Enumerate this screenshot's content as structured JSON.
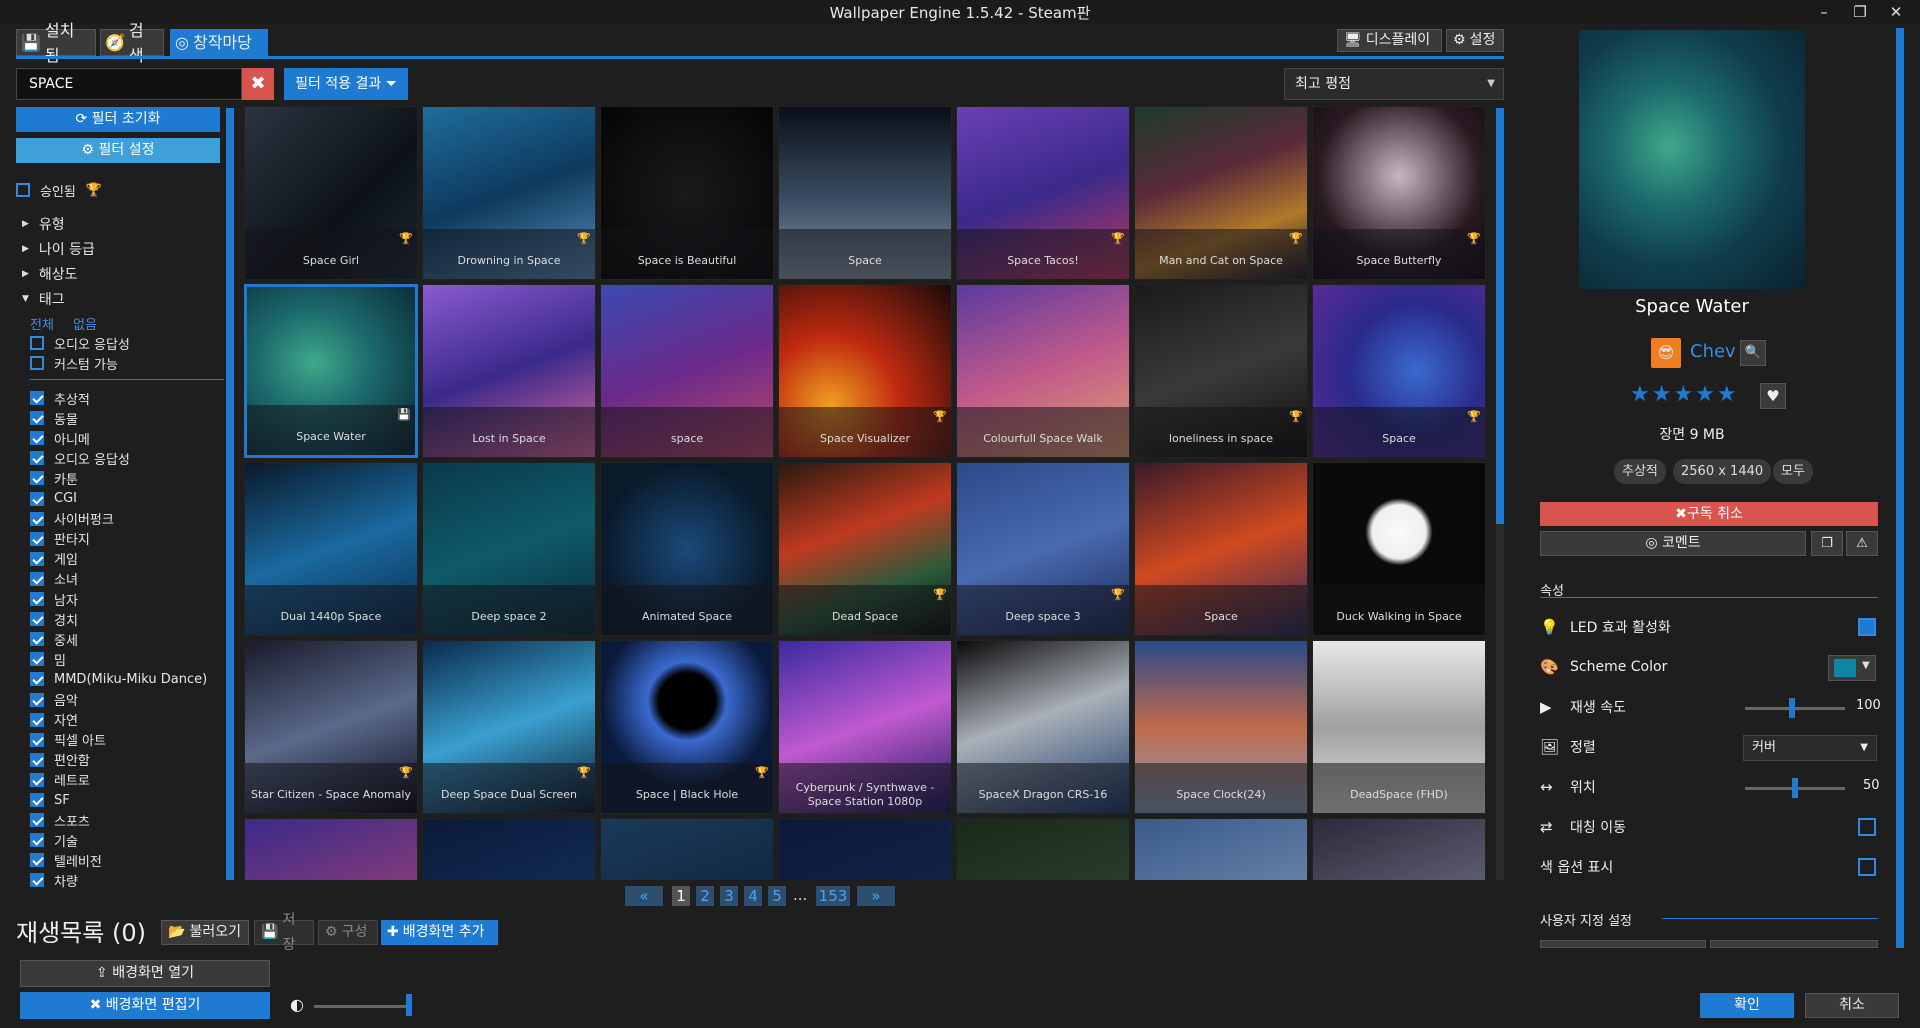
{
  "window": {
    "title": "Wallpaper Engine 1.5.42 - Steam판",
    "min": "–",
    "max": "❐",
    "close": "✕"
  },
  "tabs": [
    {
      "label": "설치됨",
      "icon": "save-icon"
    },
    {
      "label": "검색",
      "icon": "compass-icon"
    },
    {
      "label": "창작마당",
      "icon": "steam-icon",
      "active": true
    }
  ],
  "toolbar": {
    "display": "디스플레이",
    "settings": "설정"
  },
  "search": {
    "value": "SPACE",
    "clear": "✖",
    "filter_applied": "필터 적용 결과"
  },
  "sort": {
    "value": "최고 평점"
  },
  "filters": {
    "reset": "필터 초기화",
    "settings": "필터 설정",
    "approved": "승인됨",
    "sections": [
      "유형",
      "나이 등급",
      "해상도"
    ],
    "tags_label": "태그",
    "all": "전체",
    "none": "없음",
    "unchecked": [
      "오디오 응답성",
      "커스텀 가능"
    ],
    "tags": [
      "추상적",
      "동물",
      "아니메",
      "오디오 응답성",
      "카툰",
      "CGI",
      "사이버펑크",
      "판타지",
      "게임",
      "소녀",
      "남자",
      "경치",
      "중세",
      "밈",
      "MMD(Miku-Miku Dance)",
      "음악",
      "자연",
      "픽셀 아트",
      "편안함",
      "레트로",
      "SF",
      "스포츠",
      "기술",
      "텔레비전",
      "차량"
    ]
  },
  "grid": {
    "items": [
      {
        "title": "Space Girl",
        "trophy": true,
        "bg": "linear-gradient(135deg,#2a3440,#0d1218 60%,#1a2632)"
      },
      {
        "title": "Drowning in Space",
        "trophy": true,
        "bg": "linear-gradient(160deg,#1f6d9c,#0d3a5e 50%,#5a8fb7)"
      },
      {
        "title": "Space is Beautiful",
        "trophy": false,
        "bg": "radial-gradient(circle at 50% 50%,#1a1a1a,#050505)"
      },
      {
        "title": "Space",
        "trophy": false,
        "bg": "linear-gradient(180deg,#0a0f18,#3c4e63 55%,#8899aa)"
      },
      {
        "title": "Space Tacos!",
        "trophy": true,
        "bg": "linear-gradient(160deg,#6b3fb5,#3a2a8a 50%,#c03a5c)"
      },
      {
        "title": "Man and Cat on Space",
        "trophy": true,
        "bg": "linear-gradient(160deg,#1d3b2a,#5a2a3a 40%,#b0782a 70%,#1a1a2a)"
      },
      {
        "title": "Space Butterfly",
        "trophy": true,
        "bg": "radial-gradient(circle at 50% 40%,#c9b7c0,#2a1a22 60%,#0e0a0e)"
      },
      {
        "title": "Space Water",
        "trophy": false,
        "saved": true,
        "bg": "radial-gradient(ellipse at 40% 45%,#3fa98a,#1c6a6c 40%,#0a2230)"
      },
      {
        "title": "Lost in Space",
        "trophy": false,
        "bg": "linear-gradient(160deg,#8a5ad0,#3a2a8a 50%,#e06aa0)"
      },
      {
        "title": "space",
        "trophy": false,
        "bg": "linear-gradient(160deg,#3a4ab0,#6a2a8a 50%,#c04a6a)"
      },
      {
        "title": "Space Visualizer",
        "trophy": true,
        "bg": "radial-gradient(circle at 30% 70%,#f0a020,#c02a10 40%,#1a0a0a)"
      },
      {
        "title": "Colourfull Space Walk",
        "trophy": false,
        "bg": "linear-gradient(160deg,#5a3aa0,#c05a8a 50%,#e0a070)"
      },
      {
        "title": "loneliness in space",
        "trophy": true,
        "bg": "linear-gradient(160deg,#1a1a1a,#3a3a3a 50%,#0e0e0e)"
      },
      {
        "title": "Space",
        "trophy": true,
        "bg": "radial-gradient(circle at 60% 50%,#3a6ad0,#2a2a8a 50%,#5a2a9a)"
      },
      {
        "title": "Dual 1440p Space",
        "trophy": false,
        "bg": "linear-gradient(160deg,#0a1a2a,#1a6aa0 50%,#0a2a4a)"
      },
      {
        "title": "Deep space 2",
        "trophy": false,
        "bg": "linear-gradient(160deg,#0a3a4a,#0e5a6a 50%,#0a2a3a)"
      },
      {
        "title": "Animated Space",
        "trophy": false,
        "bg": "radial-gradient(circle at 50% 50%,#1a4a7a,#0a1a2a 70%)"
      },
      {
        "title": "Dead Space",
        "trophy": true,
        "bg": "linear-gradient(160deg,#2a1a10,#c03a20 40%,#2a5a3a 70%,#0a0a0a)"
      },
      {
        "title": "Deep space 3",
        "trophy": true,
        "bg": "linear-gradient(160deg,#2a4a8a,#4a6ab0 50%,#1a2a5a)"
      },
      {
        "title": "Space",
        "trophy": false,
        "bg": "linear-gradient(160deg,#3a1a2a,#d04a20 50%,#2a2a5a)"
      },
      {
        "title": "Duck Walking in Space",
        "trophy": false,
        "bg": "radial-gradient(circle at 50% 40%,#fafafa,#f0f0f0 20%,#0a0a0a 25%)"
      },
      {
        "title": "Star Citizen - Space Anomaly",
        "trophy": true,
        "bg": "linear-gradient(160deg,#1a1a2a,#5a6a8a 50%,#0a0a1a)"
      },
      {
        "title": "Deep Space Dual Screen",
        "trophy": true,
        "bg": "linear-gradient(160deg,#0a2a4a,#3aa0d0 50%,#0a1a2a)"
      },
      {
        "title": "Space | Black Hole",
        "trophy": true,
        "bg": "radial-gradient(circle at 50% 35%,#000,#000 20%,#3a6ad0 28%,#0a1a3a 60%)"
      },
      {
        "title": "Cyberpunk / Synthwave - Space Station 1080p",
        "trophy": false,
        "bg": "linear-gradient(160deg,#3a2aa0,#c05ad0 50%,#1a1a5a)"
      },
      {
        "title": "SpaceX Dragon CRS-16",
        "trophy": false,
        "bg": "linear-gradient(160deg,#0a0a0a,#aab0b8 45%,#1a3a6a)"
      },
      {
        "title": "Space Clock(24)",
        "trophy": false,
        "bg": "linear-gradient(180deg,#2a4a8a,#c06a4a 50%,#8aa0c0)"
      },
      {
        "title": "DeadSpace (FHD)",
        "trophy": false,
        "bg": "linear-gradient(180deg,#e8e8e8,#a0a0a0 50%,#e0e0e0)"
      },
      {
        "title": "",
        "trophy": false,
        "bg": "linear-gradient(160deg,#3a2a8a,#c04a6a)"
      },
      {
        "title": "",
        "trophy": false,
        "bg": "linear-gradient(160deg,#0a1a3a,#1a3a6a)"
      },
      {
        "title": "",
        "trophy": false,
        "bg": "linear-gradient(160deg,#1a3a5a,#0a1a2a)"
      },
      {
        "title": "",
        "trophy": false,
        "bg": "linear-gradient(160deg,#0a1a3a,#1a2a4a)"
      },
      {
        "title": "",
        "trophy": false,
        "bg": "linear-gradient(160deg,#1a2a1a,#3a4a3a)"
      },
      {
        "title": "",
        "trophy": false,
        "bg": "linear-gradient(160deg,#3a5a8a,#8aa0c0)"
      },
      {
        "title": "",
        "trophy": false,
        "bg": "linear-gradient(160deg,#2a2a3a,#8a8aa0)"
      }
    ]
  },
  "pagination": {
    "prev": "«",
    "next": "»",
    "pages": [
      "1",
      "2",
      "3",
      "4",
      "5"
    ],
    "ellipsis": "...",
    "last": "153"
  },
  "playlist": {
    "title": "재생목록",
    "count": "(0)",
    "load": "불러오기",
    "save": "저장",
    "configure": "구성",
    "add": "배경화면 추가"
  },
  "bottom": {
    "open": "배경화면 열기",
    "edit": "배경화면 편집기"
  },
  "details": {
    "title": "Space Water",
    "author": "Chev",
    "author_avatar": "😎",
    "rating": "★★★★★",
    "size": "장면 9 MB",
    "badges": [
      "추상적",
      "2560 x 1440",
      "모두"
    ],
    "unsubscribe": "구독 취소",
    "comment": "코멘트",
    "properties_header": "속성",
    "props": {
      "led": "LED 효과 활성화",
      "scheme": "Scheme Color",
      "scheme_color": "#0e86a6",
      "speed": "재생 속도",
      "speed_value": "100",
      "align": "정렬",
      "align_value": "커버",
      "position": "위치",
      "position_value": "50",
      "mirror": "대칭 이동",
      "color_options": "색 옵션 표시"
    },
    "custom_header": "사용자 지정 설정"
  },
  "dialog": {
    "ok": "확인",
    "cancel": "취소"
  }
}
